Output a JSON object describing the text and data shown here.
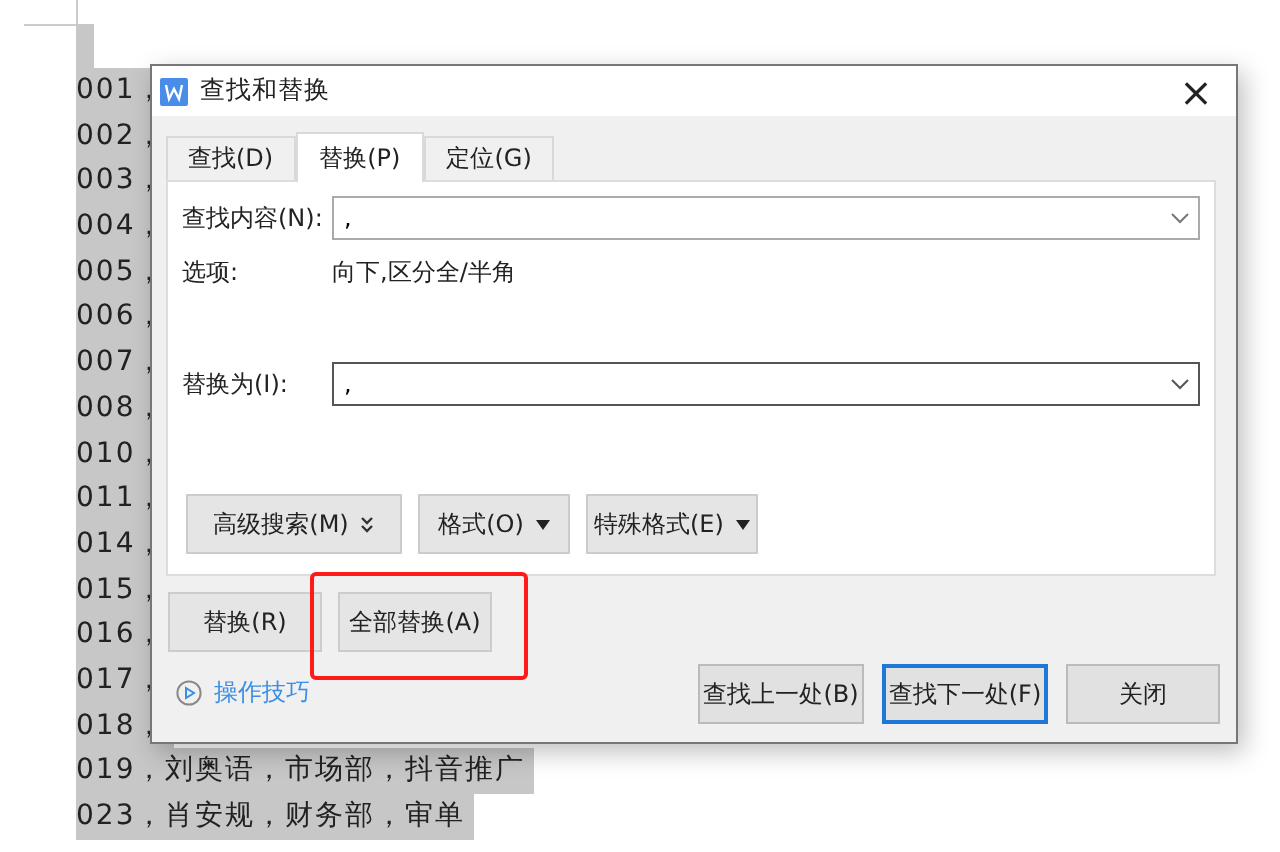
{
  "document": {
    "lines": [
      "001，",
      "002，",
      "003，",
      "004，",
      "005，",
      "006，",
      "007，",
      "008，",
      "010，",
      "011，",
      "014，",
      "015，",
      "016，",
      "017，",
      "018，",
      "019，刘奥语，市场部，抖音推广",
      "023，肖安规，财务部，审单"
    ]
  },
  "dialog": {
    "title": "查找和替换",
    "close": "×",
    "tabs": [
      {
        "label": "查找(D)",
        "selected": false
      },
      {
        "label": "替换(P)",
        "selected": true
      },
      {
        "label": "定位(G)",
        "selected": false
      }
    ],
    "find": {
      "label": "查找内容(N):",
      "value": ","
    },
    "options": {
      "label": "选项:",
      "value": "向下,区分全/半角"
    },
    "replace": {
      "label": "替换为(I):",
      "value": ","
    },
    "option_buttons": [
      {
        "label": "高级搜索(M)",
        "kind": "expand"
      },
      {
        "label": "格式(O)",
        "kind": "dropdown"
      },
      {
        "label": "特殊格式(E)",
        "kind": "dropdown"
      }
    ],
    "replace_buttons": [
      {
        "label": "替换(R)",
        "highlighted": false
      },
      {
        "label": "全部替换(A)",
        "highlighted": true
      }
    ],
    "tips_link": "操作技巧",
    "nav_buttons": [
      {
        "label": "查找上一处(B)",
        "default": false
      },
      {
        "label": "查找下一处(F)",
        "default": true
      },
      {
        "label": "关闭",
        "default": false
      }
    ]
  }
}
